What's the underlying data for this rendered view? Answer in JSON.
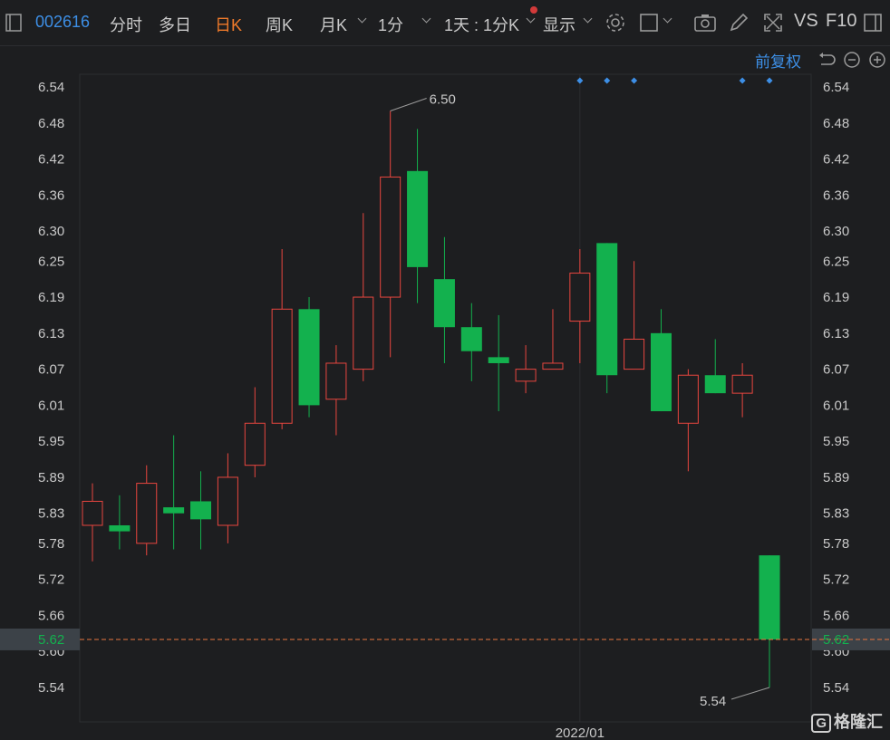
{
  "toolbar": {
    "code": "002616",
    "tabs": [
      "分时",
      "多日",
      "日K",
      "周K",
      "月K",
      "1分"
    ],
    "active_tab": "日K",
    "range_label": "1天 : 1分K",
    "display_label": "显示",
    "vs_label": "VS",
    "f10_label": "F10",
    "adjust_label": "前复权"
  },
  "watermark": "格隆汇",
  "chart_data": {
    "type": "candlestick",
    "ylim": [
      5.5,
      6.57
    ],
    "y_ticks": [
      "6.54",
      "6.48",
      "6.42",
      "6.36",
      "6.30",
      "6.25",
      "6.19",
      "6.13",
      "6.07",
      "6.01",
      "5.95",
      "5.89",
      "5.83",
      "5.78",
      "5.72",
      "5.66",
      "5.60",
      "5.54"
    ],
    "y_tick_values": [
      6.54,
      6.48,
      6.42,
      6.36,
      6.3,
      6.25,
      6.19,
      6.13,
      6.07,
      6.01,
      5.95,
      5.89,
      5.83,
      5.78,
      5.72,
      5.66,
      5.6,
      5.54
    ],
    "x_label": "2022/01",
    "x_label_index": 18,
    "current_price": "5.62",
    "current_value": 5.62,
    "max_annotation": {
      "text": "6.50",
      "index": 11,
      "value": 6.5
    },
    "min_annotation": {
      "text": "5.54",
      "index": 25,
      "value": 5.54
    },
    "event_marker_indices": [
      18,
      19,
      20,
      24,
      25
    ],
    "colors": {
      "up": "#e8463f",
      "down": "#13b14e",
      "grid": "#2c2d30"
    },
    "candles": [
      {
        "open": 5.81,
        "high": 5.88,
        "low": 5.75,
        "close": 5.85
      },
      {
        "open": 5.81,
        "high": 5.86,
        "low": 5.77,
        "close": 5.8
      },
      {
        "open": 5.78,
        "high": 5.91,
        "low": 5.76,
        "close": 5.88
      },
      {
        "open": 5.84,
        "high": 5.96,
        "low": 5.77,
        "close": 5.83
      },
      {
        "open": 5.85,
        "high": 5.9,
        "low": 5.77,
        "close": 5.82
      },
      {
        "open": 5.81,
        "high": 5.93,
        "low": 5.78,
        "close": 5.89
      },
      {
        "open": 5.91,
        "high": 6.04,
        "low": 5.89,
        "close": 5.98
      },
      {
        "open": 5.98,
        "high": 6.27,
        "low": 5.97,
        "close": 6.17
      },
      {
        "open": 6.17,
        "high": 6.19,
        "low": 5.99,
        "close": 6.01
      },
      {
        "open": 6.02,
        "high": 6.11,
        "low": 5.96,
        "close": 6.08
      },
      {
        "open": 6.07,
        "high": 6.33,
        "low": 6.05,
        "close": 6.19
      },
      {
        "open": 6.19,
        "high": 6.5,
        "low": 6.09,
        "close": 6.39
      },
      {
        "open": 6.4,
        "high": 6.47,
        "low": 6.18,
        "close": 6.24
      },
      {
        "open": 6.22,
        "high": 6.29,
        "low": 6.08,
        "close": 6.14
      },
      {
        "open": 6.14,
        "high": 6.18,
        "low": 6.05,
        "close": 6.1
      },
      {
        "open": 6.09,
        "high": 6.16,
        "low": 6.0,
        "close": 6.08
      },
      {
        "open": 6.05,
        "high": 6.11,
        "low": 6.03,
        "close": 6.07
      },
      {
        "open": 6.07,
        "high": 6.17,
        "low": 6.07,
        "close": 6.08
      },
      {
        "open": 6.15,
        "high": 6.27,
        "low": 6.08,
        "close": 6.23
      },
      {
        "open": 6.28,
        "high": 6.28,
        "low": 6.03,
        "close": 6.06
      },
      {
        "open": 6.07,
        "high": 6.25,
        "low": 6.07,
        "close": 6.12
      },
      {
        "open": 6.13,
        "high": 6.17,
        "low": 6.0,
        "close": 6.0
      },
      {
        "open": 5.98,
        "high": 6.07,
        "low": 5.9,
        "close": 6.06
      },
      {
        "open": 6.06,
        "high": 6.12,
        "low": 6.03,
        "close": 6.03
      },
      {
        "open": 6.03,
        "high": 6.08,
        "low": 5.99,
        "close": 6.06
      },
      {
        "open": 5.76,
        "high": 5.76,
        "low": 5.54,
        "close": 5.62
      }
    ]
  }
}
